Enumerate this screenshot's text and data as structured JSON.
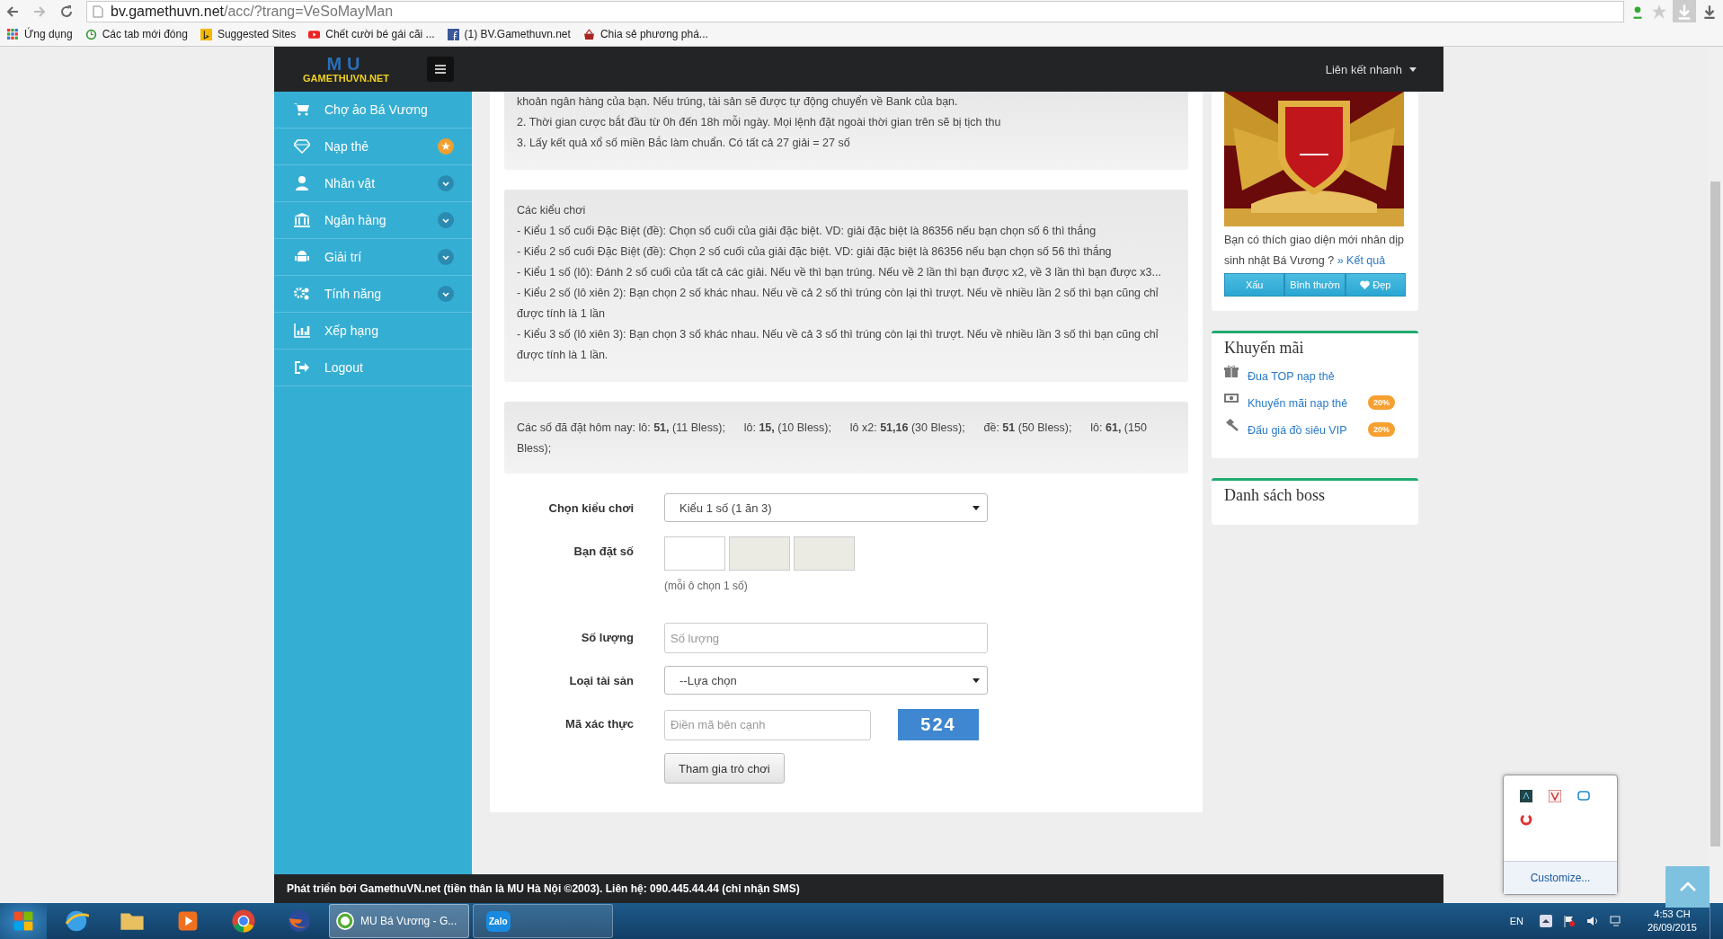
{
  "browser": {
    "url_host": "bv.gamethuvn.net",
    "url_path": "/acc/?trang=VeSoMayMan",
    "bookmarks": [
      {
        "label": "Ứng dụng"
      },
      {
        "label": "Các tab mới đóng"
      },
      {
        "label": "Suggested Sites"
      },
      {
        "label": "Chết cười bé gái cãi ..."
      },
      {
        "label": "(1) BV.Gamethuvn.net"
      },
      {
        "label": "Chia sẻ phương phá..."
      }
    ]
  },
  "header": {
    "logo_mark": "MU",
    "logo": "GAMETHUVN.NET",
    "quick_links": "Liên kết nhanh"
  },
  "sidebar": {
    "items": [
      {
        "label": "Chợ ảo Bá Vương",
        "kind": "plain"
      },
      {
        "label": "Nạp thẻ",
        "kind": "starred"
      },
      {
        "label": "Nhân vật",
        "kind": "submenu"
      },
      {
        "label": "Ngân hàng",
        "kind": "submenu"
      },
      {
        "label": "Giải trí",
        "kind": "submenu"
      },
      {
        "label": "Tính năng",
        "kind": "submenu"
      },
      {
        "label": "Xếp hạng",
        "kind": "plain"
      },
      {
        "label": "Logout",
        "kind": "plain"
      }
    ]
  },
  "rules": {
    "lines": [
      "khoản ngân hàng của bạn. Nếu trúng, tài sản sẽ được tự động chuyển về Bank của bạn.",
      "2. Thời gian cược bắt đầu từ 0h đến 18h mỗi ngày. Mọi lệnh đặt ngoài thời gian trên sẽ bị tịch thu",
      "3. Lấy kết quả xổ số miền Bắc làm chuẩn. Có tất cả 27 giải = 27 số"
    ]
  },
  "modes": {
    "title": "Các kiểu chơi",
    "lines": [
      "- Kiểu 1 số cuối Đặc Biệt (đề): Chọn số cuối của giải đặc biệt. VD: giải đặc biệt là 86356 nếu bạn chọn số 6 thì thắng",
      "- Kiểu 2 số cuối Đặc Biệt (đề): Chọn 2 số cuối của giải đặc biệt. VD: giải đặc biệt là 86356 nếu bạn chọn số 56 thì thắng",
      "- Kiểu 1 số (lô): Đánh 2 số cuối của tất cả các giải. Nếu về thì bạn trúng. Nếu về 2 lần thì bạn được x2, về 3 lần thì bạn được x3...",
      "- Kiểu 2 số (lô xiên 2): Bạn chọn 2 số khác nhau. Nếu về cả 2 số thì trúng còn lại thì trượt. Nếu về nhiều lần 2 số thì bạn cũng chỉ được tính là 1 lần",
      "- Kiểu 3 số (lô xiên 3): Bạn chọn 3 số khác nhau. Nếu về cả 3 số thì trúng còn lại thì trượt. Nếu về nhiều lần 3 số thì bạn cũng chỉ được tính là 1 lần."
    ]
  },
  "placed": "Các số đã đặt hôm nay: lô: **51,** (11 Bless);      lô: **15,** (10 Bless);      lô x2: **51,16** (30 Bless);      đề: **51** (50 Bless);      lô: **61,** (150 Bless);",
  "form": {
    "fields": [
      {
        "kind": "select",
        "label": "Chọn kiểu chơi",
        "value": "Kiểu 1 số (1 ăn 3)"
      },
      {
        "kind": "digits",
        "label": "Bạn đặt số",
        "boxes": [
          {
            "disabled": false
          },
          {
            "disabled": true
          },
          {
            "disabled": true
          }
        ],
        "hint": "(mỗi ô chọn 1 số)"
      },
      {
        "kind": "input",
        "label": "Số lượng",
        "placeholder": "Số lượng"
      },
      {
        "kind": "select",
        "label": "Loại tài sản",
        "value": "--Lựa chọn"
      },
      {
        "kind": "captcha",
        "label": "Mã xác thực",
        "placeholder": "Điền mã bên cạnh",
        "code": "524"
      }
    ],
    "submit": "Tham gia trò chơi"
  },
  "poll": {
    "question": "Bạn có thích giao diện mới nhân dịp sinh nhật Bá Vương ?",
    "result_link": "» Kết quả",
    "buttons": [
      {
        "label": "Xấu",
        "heart": false
      },
      {
        "label": "Bình thườn",
        "heart": false
      },
      {
        "label": "Đẹp",
        "heart": true
      }
    ]
  },
  "promo": {
    "title": "Khuyến mãi",
    "items": [
      {
        "label": "Đua TOP nạp thẻ"
      },
      {
        "label": "Khuyến mãi nạp thẻ",
        "badge": "20%"
      },
      {
        "label": "Đấu giá đồ siêu VIP",
        "badge": "20%"
      }
    ]
  },
  "boss": {
    "title": "Danh sách boss"
  },
  "footer": "Phát triển bởi GamethuVN.net (tiền thân là MU Hà Nội ©2003). Liên hệ: 090.445.44.44 (chỉ nhận SMS)",
  "tray_popup": {
    "customize": "Customize..."
  },
  "taskbar": {
    "window": "MU Bá Vương - G...",
    "zalo": "Zalo",
    "language": "EN",
    "time": "4:53 CH",
    "date": "26/09/2015"
  }
}
